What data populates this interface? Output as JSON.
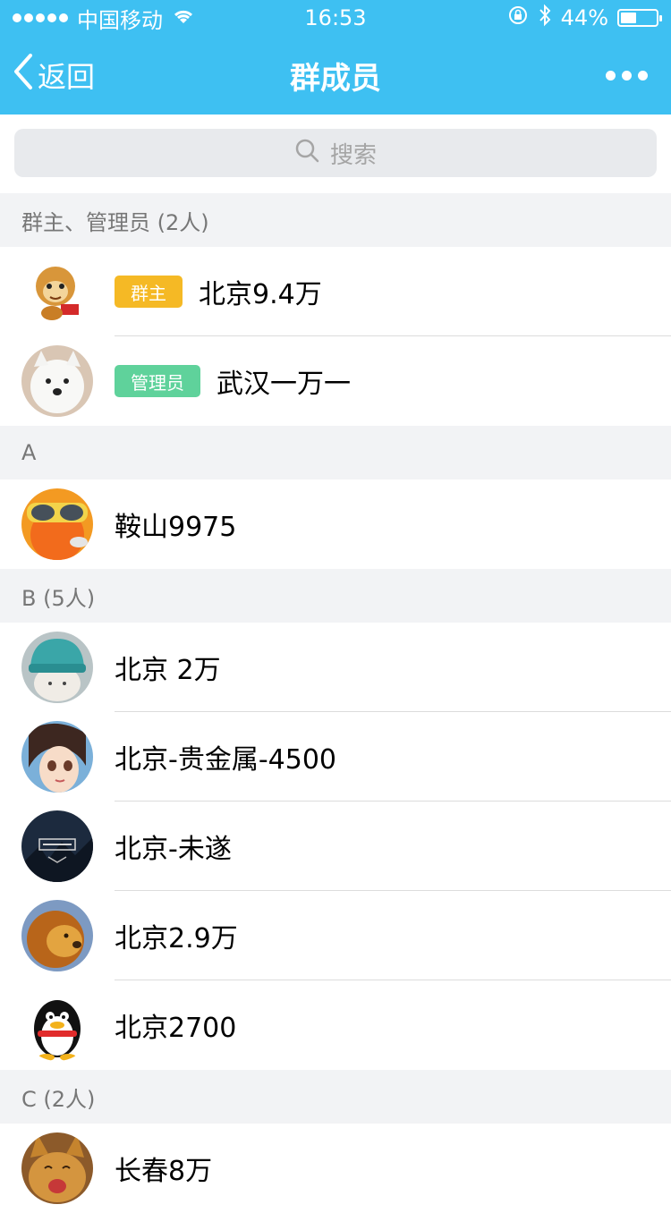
{
  "status_bar": {
    "carrier": "中国移动",
    "time": "16:53",
    "battery_text": "44%",
    "battery_level": 0.44
  },
  "nav": {
    "back_label": "返回",
    "title": "群成员"
  },
  "search": {
    "placeholder": "搜索"
  },
  "colors": {
    "nav_bg": "#3ec0f2",
    "owner_badge": "#f5b925",
    "admin_badge": "#5fd29b"
  },
  "sections": [
    {
      "header": "群主、管理员 (2人)",
      "members": [
        {
          "name": "北京9.4万",
          "badge": "群主",
          "badge_color": "#f5b925",
          "avatar": "monkey-avatar"
        },
        {
          "name": "武汉一万一",
          "badge": "管理员",
          "badge_color": "#5fd29b",
          "avatar": "white-dog-avatar"
        }
      ]
    },
    {
      "header": "A",
      "members": [
        {
          "name": "鞍山9975",
          "avatar": "goggles-avatar"
        }
      ]
    },
    {
      "header": "B (5人)",
      "members": [
        {
          "name": "北京 2万",
          "avatar": "cat-in-hat-avatar"
        },
        {
          "name": "北京-贵金属-4500",
          "avatar": "anime-girl-avatar"
        },
        {
          "name": "北京-未遂",
          "avatar": "dark-logo-avatar"
        },
        {
          "name": "北京2.9万",
          "avatar": "lion-avatar"
        },
        {
          "name": "北京2700",
          "avatar": "penguin-avatar"
        }
      ]
    },
    {
      "header": "C (2人)",
      "members": [
        {
          "name": "长春8万",
          "avatar": "kitten-avatar"
        }
      ]
    }
  ]
}
